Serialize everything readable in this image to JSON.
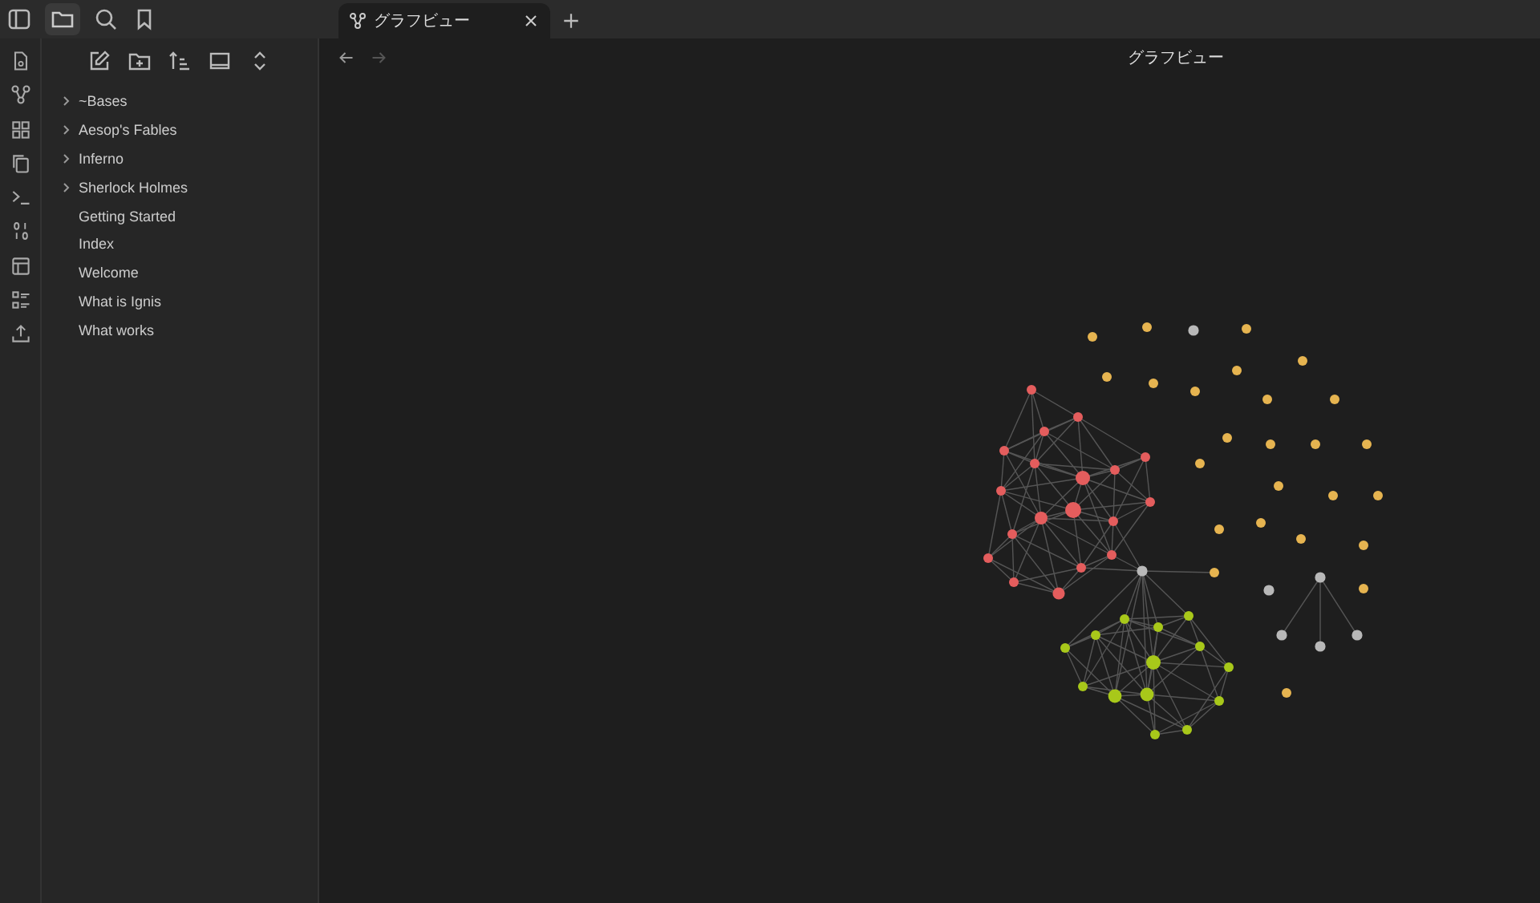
{
  "tabs": [
    {
      "label": "グラフビュー",
      "selected": true
    }
  ],
  "view_title": "グラフビュー",
  "file_tree": [
    {
      "label": "~Bases",
      "kind": "folder",
      "expanded": false
    },
    {
      "label": "Aesop's Fables",
      "kind": "folder",
      "expanded": false
    },
    {
      "label": "Inferno",
      "kind": "folder",
      "expanded": false
    },
    {
      "label": "Sherlock Holmes",
      "kind": "folder",
      "expanded": false
    },
    {
      "label": "Getting Started",
      "kind": "file"
    },
    {
      "label": "Index",
      "kind": "file"
    },
    {
      "label": "Welcome",
      "kind": "file"
    },
    {
      "label": "What is Ignis",
      "kind": "file"
    },
    {
      "label": "What works",
      "kind": "file"
    }
  ]
}
